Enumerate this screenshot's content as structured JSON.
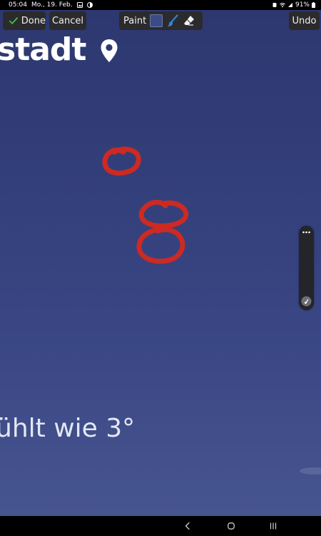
{
  "status_bar": {
    "time": "05:04",
    "date": "Mo., 19. Feb.",
    "battery": "91%"
  },
  "toolbar": {
    "done_label": "Done",
    "cancel_label": "Cancel",
    "paint_label": "Paint",
    "undo_label": "Undo",
    "swatch_color": "#3c4b86",
    "brush_color": "#2f86d6"
  },
  "canvas": {
    "city_fragment": "stadt",
    "feels_like_fragment": "ühlt wie 3°",
    "stroke_color": "#cc2a22"
  },
  "icons": {
    "done": "check-icon",
    "location": "location-pin-icon",
    "brush": "brush-icon",
    "eraser": "eraser-icon",
    "handle_top": "more-icon",
    "handle_bottom": "edit-icon",
    "nav": [
      "back-icon",
      "home-icon",
      "recents-icon"
    ]
  }
}
